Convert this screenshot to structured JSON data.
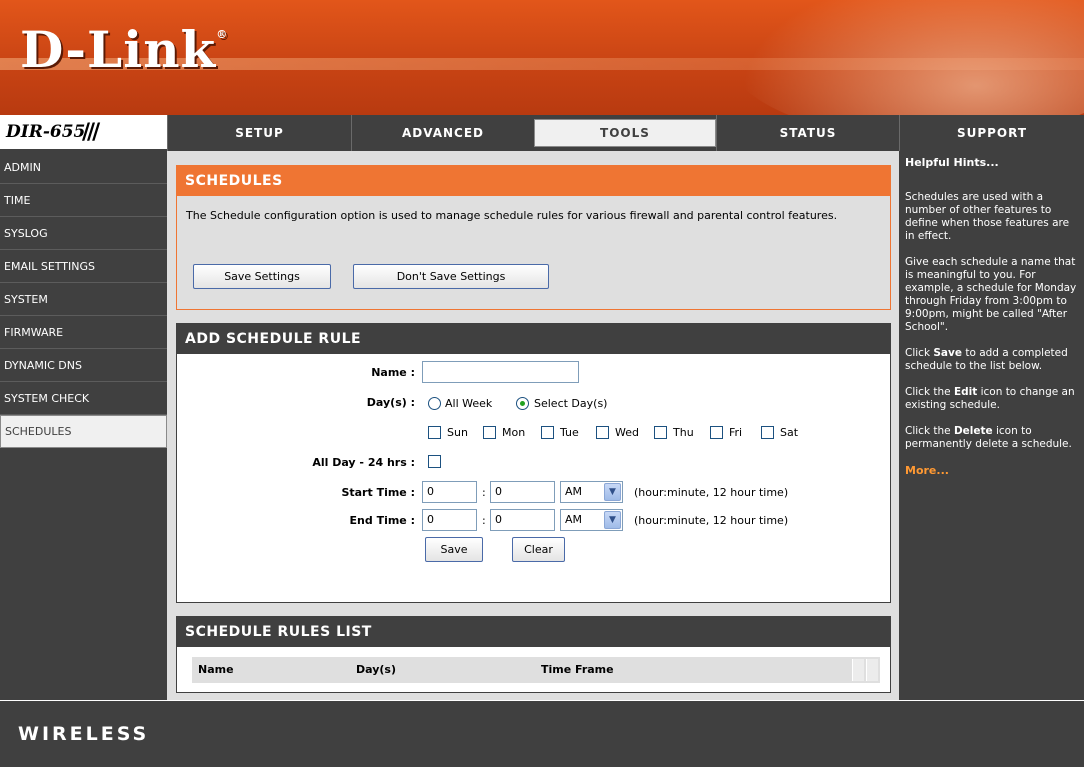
{
  "brand": {
    "logo": "D-Link",
    "model": "DIR-655",
    "model_bars": "///",
    "footer": "WIRELESS"
  },
  "nav": {
    "tabs": [
      {
        "label": "SETUP"
      },
      {
        "label": "ADVANCED"
      },
      {
        "label": "TOOLS"
      },
      {
        "label": "STATUS"
      },
      {
        "label": "SUPPORT"
      }
    ],
    "active_tab": "TOOLS"
  },
  "sidebar": {
    "items": [
      {
        "label": "ADMIN"
      },
      {
        "label": "TIME"
      },
      {
        "label": "SYSLOG"
      },
      {
        "label": "EMAIL SETTINGS"
      },
      {
        "label": "SYSTEM"
      },
      {
        "label": "FIRMWARE"
      },
      {
        "label": "DYNAMIC DNS"
      },
      {
        "label": "SYSTEM CHECK"
      },
      {
        "label": "SCHEDULES"
      }
    ],
    "active_item": "SCHEDULES"
  },
  "schedules": {
    "title": "SCHEDULES",
    "description": "The Schedule configuration option is used to manage schedule rules for various firewall and parental control features.",
    "save_button": "Save Settings",
    "dont_save_button": "Don't Save Settings"
  },
  "add_rule": {
    "title": "ADD SCHEDULE RULE",
    "name_label": "Name :",
    "name_value": "",
    "days_label": "Day(s) :",
    "all_week_label": "All Week",
    "select_days_label": "Select Day(s)",
    "selected_mode": "Select Day(s)",
    "days": [
      "Sun",
      "Mon",
      "Tue",
      "Wed",
      "Thu",
      "Fri",
      "Sat"
    ],
    "all_day_label": "All Day - 24 hrs :",
    "start_time_label": "Start Time :",
    "start_hour": "0",
    "start_minute": "0",
    "start_ampm": "AM",
    "end_time_label": "End Time :",
    "end_hour": "0",
    "end_minute": "0",
    "end_ampm": "AM",
    "colon": ":",
    "time_hint": "(hour:minute, 12 hour time)",
    "save_button": "Save",
    "clear_button": "Clear"
  },
  "rules_list": {
    "title": "SCHEDULE RULES LIST",
    "columns": [
      "Name",
      "Day(s)",
      "Time Frame"
    ]
  },
  "hints": {
    "title": "Helpful Hints...",
    "p1": "Schedules are used with a number of other features to define when those features are in effect.",
    "p2": "Give each schedule a name that is meaningful to you. For example, a schedule for Monday through Friday from 3:00pm to 9:00pm, might be called \"After School\".",
    "p3_pre": "Click ",
    "p3_bold": "Save",
    "p3_post": " to add a completed schedule to the list below.",
    "p4_pre": "Click the ",
    "p4_bold": "Edit",
    "p4_post": " icon to change an existing schedule.",
    "p5_pre": "Click the ",
    "p5_bold": "Delete",
    "p5_post": " icon to permanently delete a schedule.",
    "more": "More..."
  },
  "colors": {
    "orange": "#ef7533",
    "dark": "#404040",
    "light": "#dfdfdf"
  }
}
